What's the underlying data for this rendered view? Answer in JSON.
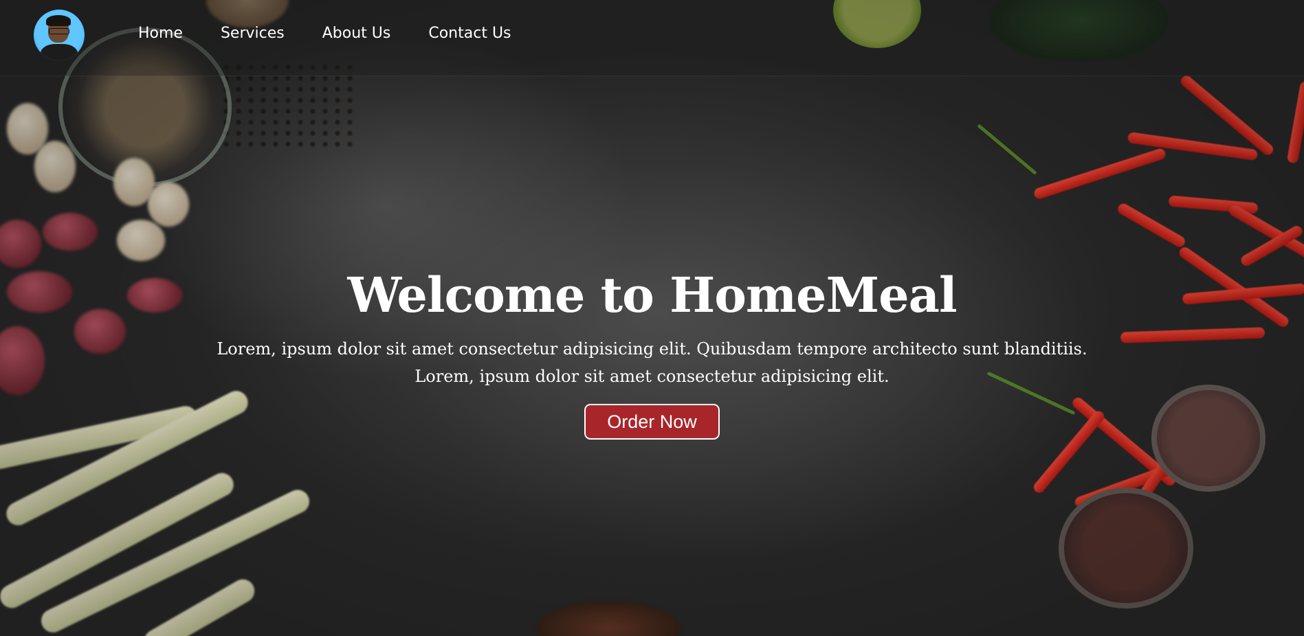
{
  "nav": {
    "avatar_alt": "profile avatar",
    "links": [
      {
        "label": "Home"
      },
      {
        "label": "Services"
      },
      {
        "label": "About Us"
      },
      {
        "label": "Contact Us"
      }
    ]
  },
  "hero": {
    "title": "Welcome to HomeMeal",
    "line1": "Lorem, ipsum dolor sit amet consectetur adipisicing elit. Quibusdam tempore architecto sunt blanditiis.",
    "line2": "Lorem, ipsum dolor sit amet consectetur adipisicing elit.",
    "cta_label": "Order Now",
    "background_image": "dark slate table with chilies, garlic, shallots and lemongrass"
  },
  "colors": {
    "cta_background": "#a8262a",
    "text": "#ffffff",
    "nav_background": "rgba(30,30,30,0.35)"
  }
}
